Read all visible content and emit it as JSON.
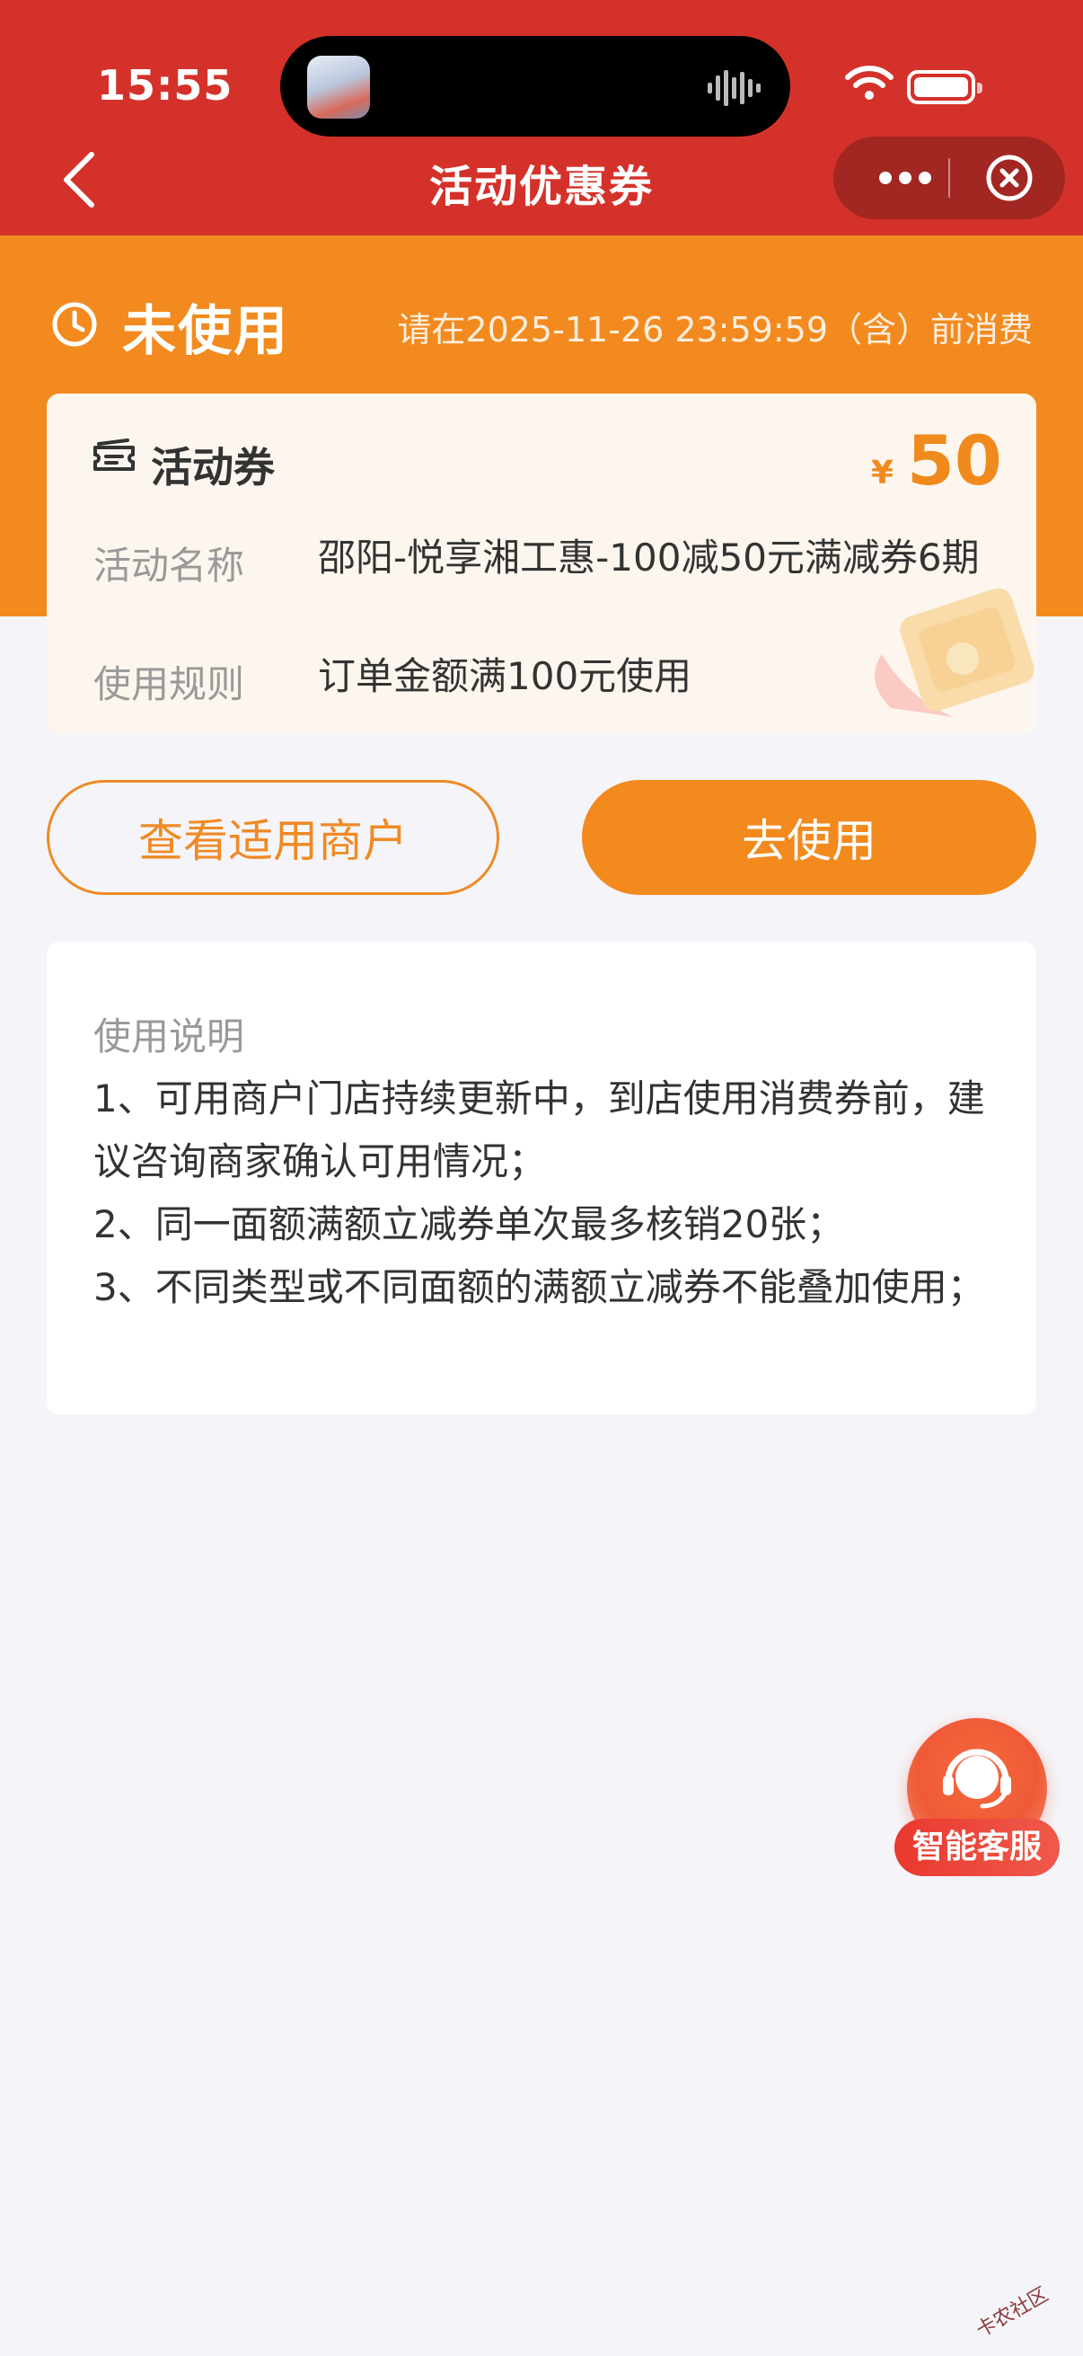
{
  "status_bar": {
    "time": "15:55"
  },
  "nav": {
    "title": "活动优惠券"
  },
  "coupon_status": {
    "label": "未使用",
    "expire": "请在2025-11-26 23:59:59（含）前消费"
  },
  "coupon": {
    "type": "活动券",
    "currency": "¥",
    "amount": "50",
    "name_label": "活动名称",
    "name_value": "邵阳-悦享湘工惠-100减50元满减券6期",
    "rule_label": "使用规则",
    "rule_value": "订单金额满100元使用"
  },
  "actions": {
    "view_merchants": "查看适用商户",
    "use_now": "去使用"
  },
  "instructions": {
    "title": "使用说明",
    "lines": [
      "1、可用商户门店持续更新中，到店使用消费券前，建议咨询商家确认可用情况；",
      "2、同一面额满额立减券单次最多核销20张；",
      "3、不同类型或不同面额的满额立减券不能叠加使用；"
    ]
  },
  "service": {
    "label": "智能客服"
  },
  "watermark": "卡农社区",
  "colors": {
    "header_red": "#d4312a",
    "orange": "#f28a1e",
    "coupon_bg": "#fdf6ee",
    "page_bg": "#f5f5f9"
  },
  "icons": [
    "back-arrow-icon",
    "more-dots-icon",
    "close-circle-icon",
    "clock-icon",
    "ticket-icon",
    "headset-icon",
    "wifi-icon",
    "battery-icon"
  ]
}
